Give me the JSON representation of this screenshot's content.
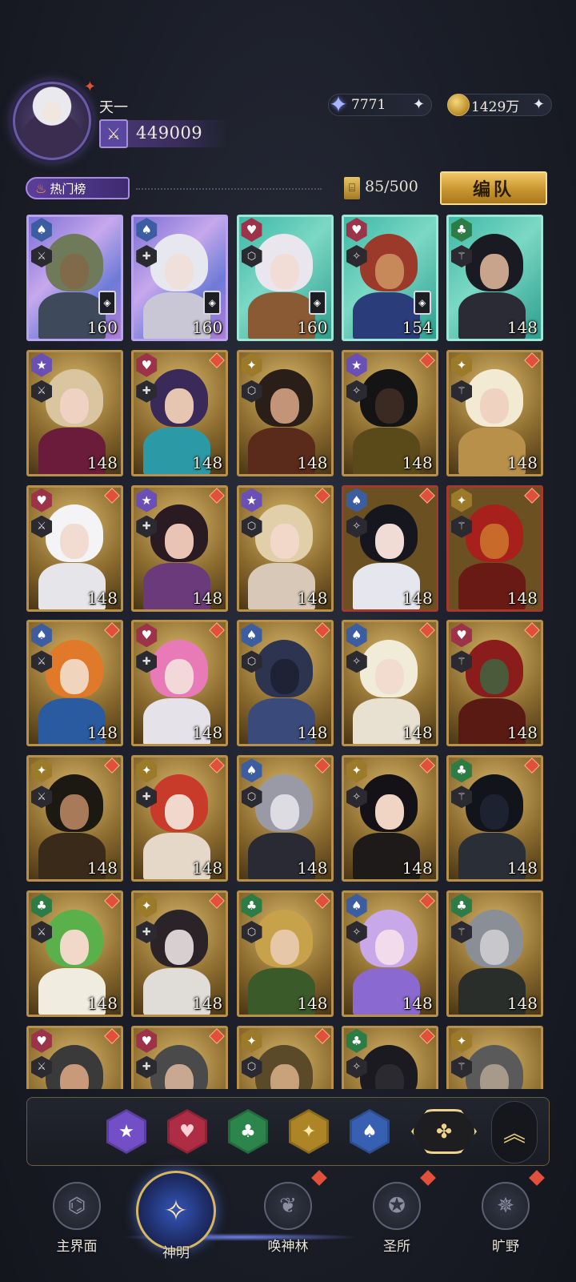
{
  "player": {
    "name": "天一",
    "power": "449009"
  },
  "resources": {
    "gems": "7771",
    "gold": "1429万",
    "plus": "+"
  },
  "filter": {
    "hot_label": "热门榜",
    "capacity": "85/500",
    "team_button": "编队"
  },
  "cards": [
    {
      "faction": "spade",
      "level": "160",
      "frame": "rare-purple",
      "rank": true,
      "dot": false,
      "skin": "#7f6a4a",
      "hair": "#6f7a5a",
      "body": "#3e4a5c"
    },
    {
      "faction": "spade",
      "level": "160",
      "frame": "rare-purple",
      "rank": true,
      "dot": false,
      "skin": "#efe0dc",
      "hair": "#e7e7ef",
      "body": "#c9c7d6"
    },
    {
      "faction": "heart",
      "level": "160",
      "frame": "rare-teal",
      "rank": true,
      "dot": false,
      "skin": "#f2dcd6",
      "hair": "#e9e6ee",
      "body": "#8a5a34"
    },
    {
      "faction": "heart",
      "level": "154",
      "frame": "rare-teal",
      "rank": true,
      "dot": false,
      "skin": "#c7885a",
      "hair": "#9b3a2a",
      "body": "#2a3d7a"
    },
    {
      "faction": "club",
      "level": "148",
      "frame": "rare-teal",
      "rank": false,
      "dot": false,
      "skin": "#c9a48c",
      "hair": "#1a1a22",
      "body": "#2b2b36"
    },
    {
      "faction": "star",
      "level": "148",
      "frame": "",
      "rank": false,
      "dot": false,
      "skin": "#efd2c2",
      "hair": "#d9c6a0",
      "body": "#6a1c3a"
    },
    {
      "faction": "heart",
      "level": "148",
      "frame": "",
      "rank": false,
      "dot": true,
      "skin": "#e6c6b0",
      "hair": "#3a2a5a",
      "body": "#2c9aa6"
    },
    {
      "faction": "sun",
      "level": "148",
      "frame": "",
      "rank": false,
      "dot": false,
      "skin": "#c49478",
      "hair": "#2a1e18",
      "body": "#5a2a1a"
    },
    {
      "faction": "star",
      "level": "148",
      "frame": "",
      "rank": false,
      "dot": true,
      "skin": "#3a2a22",
      "hair": "#141414",
      "body": "#5a4a1a"
    },
    {
      "faction": "sun",
      "level": "148",
      "frame": "",
      "rank": false,
      "dot": true,
      "skin": "#f0d2c0",
      "hair": "#f2ead2",
      "body": "#b8904a"
    },
    {
      "faction": "heart",
      "level": "148",
      "frame": "",
      "rank": false,
      "dot": true,
      "skin": "#f2dcd2",
      "hair": "#f4f4f6",
      "body": "#e6e6ea"
    },
    {
      "faction": "star",
      "level": "148",
      "frame": "",
      "rank": false,
      "dot": true,
      "skin": "#e9c4b4",
      "hair": "#2a1a22",
      "body": "#6a3a7a"
    },
    {
      "faction": "star",
      "level": "148",
      "frame": "",
      "rank": false,
      "dot": true,
      "skin": "#f2d8c8",
      "hair": "#e0cfa8",
      "body": "#d8c8b8"
    },
    {
      "faction": "spade",
      "level": "148",
      "frame": "red-frame",
      "rank": false,
      "dot": true,
      "skin": "#f0dcd4",
      "hair": "#16161e",
      "body": "#e6e6ee"
    },
    {
      "faction": "sun",
      "level": "148",
      "frame": "red-frame",
      "rank": false,
      "dot": true,
      "skin": "#c86a2a",
      "hair": "#a8201c",
      "body": "#6a1a14"
    },
    {
      "faction": "spade",
      "level": "148",
      "frame": "",
      "rank": false,
      "dot": true,
      "skin": "#f0d4bc",
      "hair": "#e07a2a",
      "body": "#2a5aa0"
    },
    {
      "faction": "heart",
      "level": "148",
      "frame": "",
      "rank": false,
      "dot": true,
      "skin": "#f2d8d8",
      "hair": "#e87ab8",
      "body": "#e6e2ea"
    },
    {
      "faction": "spade",
      "level": "148",
      "frame": "",
      "rank": false,
      "dot": true,
      "skin": "#1e2234",
      "hair": "#2c3450",
      "body": "#3a4a7a"
    },
    {
      "faction": "spade",
      "level": "148",
      "frame": "",
      "rank": false,
      "dot": true,
      "skin": "#f2dcd0",
      "hair": "#f0ecd8",
      "body": "#e8e0d0"
    },
    {
      "faction": "heart",
      "level": "148",
      "frame": "",
      "rank": false,
      "dot": true,
      "skin": "#4a5a3a",
      "hair": "#8a1c1c",
      "body": "#5a1a14"
    },
    {
      "faction": "sun",
      "level": "148",
      "frame": "",
      "rank": false,
      "dot": true,
      "skin": "#a87a5a",
      "hair": "#1c1812",
      "body": "#3a2a1a"
    },
    {
      "faction": "sun",
      "level": "148",
      "frame": "",
      "rank": false,
      "dot": true,
      "skin": "#f2d8cc",
      "hair": "#c83a2a",
      "body": "#e6d8c8"
    },
    {
      "faction": "spade",
      "level": "148",
      "frame": "",
      "rank": false,
      "dot": true,
      "skin": "#dcdce2",
      "hair": "#9a9aa6",
      "body": "#2a2a34"
    },
    {
      "faction": "sun",
      "level": "148",
      "frame": "",
      "rank": false,
      "dot": true,
      "skin": "#f0d4c4",
      "hair": "#141216",
      "body": "#1e1a1a"
    },
    {
      "faction": "club",
      "level": "148",
      "frame": "",
      "rank": false,
      "dot": true,
      "skin": "#1c2230",
      "hair": "#12141c",
      "body": "#2a2e36"
    },
    {
      "faction": "club",
      "level": "148",
      "frame": "",
      "rank": false,
      "dot": true,
      "skin": "#f2d8c8",
      "hair": "#5ab04a",
      "body": "#f0ece0"
    },
    {
      "faction": "sun",
      "level": "148",
      "frame": "",
      "rank": false,
      "dot": true,
      "skin": "#d8d0d0",
      "hair": "#2a2428",
      "body": "#e0dcd8"
    },
    {
      "faction": "club",
      "level": "148",
      "frame": "",
      "rank": false,
      "dot": true,
      "skin": "#e6c8a8",
      "hair": "#c8a24a",
      "body": "#3a5a2a"
    },
    {
      "faction": "spade",
      "level": "148",
      "frame": "",
      "rank": false,
      "dot": true,
      "skin": "#f2dcec",
      "hair": "#c8a8e8",
      "body": "#8a6ad0"
    },
    {
      "faction": "club",
      "level": "148",
      "frame": "",
      "rank": false,
      "dot": false,
      "skin": "#c8c8cc",
      "hair": "#8a8e96",
      "body": "#2a2e2a"
    },
    {
      "faction": "heart",
      "level": "",
      "frame": "",
      "rank": false,
      "dot": true,
      "skin": "#c89a7a",
      "hair": "#3a3a3a",
      "body": "#5a4a3a"
    },
    {
      "faction": "heart",
      "level": "",
      "frame": "",
      "rank": false,
      "dot": true,
      "skin": "#c8a890",
      "hair": "#4a4a4a",
      "body": "#5a4a3a"
    },
    {
      "faction": "sun",
      "level": "",
      "frame": "",
      "rank": false,
      "dot": true,
      "skin": "#c8a27a",
      "hair": "#5a4a2a",
      "body": "#5a4a3a"
    },
    {
      "faction": "club",
      "level": "",
      "frame": "",
      "rank": false,
      "dot": true,
      "skin": "#2a2a30",
      "hair": "#1a1a20",
      "body": "#3a3a3a"
    },
    {
      "faction": "sun",
      "level": "",
      "frame": "",
      "rank": false,
      "dot": false,
      "skin": "#a89a8a",
      "hair": "#5a5a5a",
      "body": "#4a4a3a"
    }
  ],
  "faction_symbols": {
    "spade": "♠",
    "heart": "♥",
    "club": "♣",
    "star": "★",
    "sun": "✦"
  },
  "role_symbols": [
    "⚔",
    "✚",
    "⬡",
    "✧",
    "⚚"
  ],
  "filter_bar": {
    "star": "★",
    "heart": "♥",
    "club": "♣",
    "sun": "✦",
    "spade": "♠",
    "all": "✤",
    "collapse": "︽"
  },
  "nav": {
    "items": [
      {
        "label": "主界面",
        "icon": "world-icon",
        "glyph": "⌬",
        "active": false,
        "dot": false
      },
      {
        "label": "神明",
        "icon": "book-icon",
        "glyph": "✧",
        "active": true,
        "dot": false
      },
      {
        "label": "唤神林",
        "icon": "tree-icon",
        "glyph": "❦",
        "active": false,
        "dot": true
      },
      {
        "label": "圣所",
        "icon": "sanctuary-icon",
        "glyph": "✪",
        "active": false,
        "dot": true
      },
      {
        "label": "旷野",
        "icon": "compass-icon",
        "glyph": "✵",
        "active": false,
        "dot": true
      }
    ]
  }
}
